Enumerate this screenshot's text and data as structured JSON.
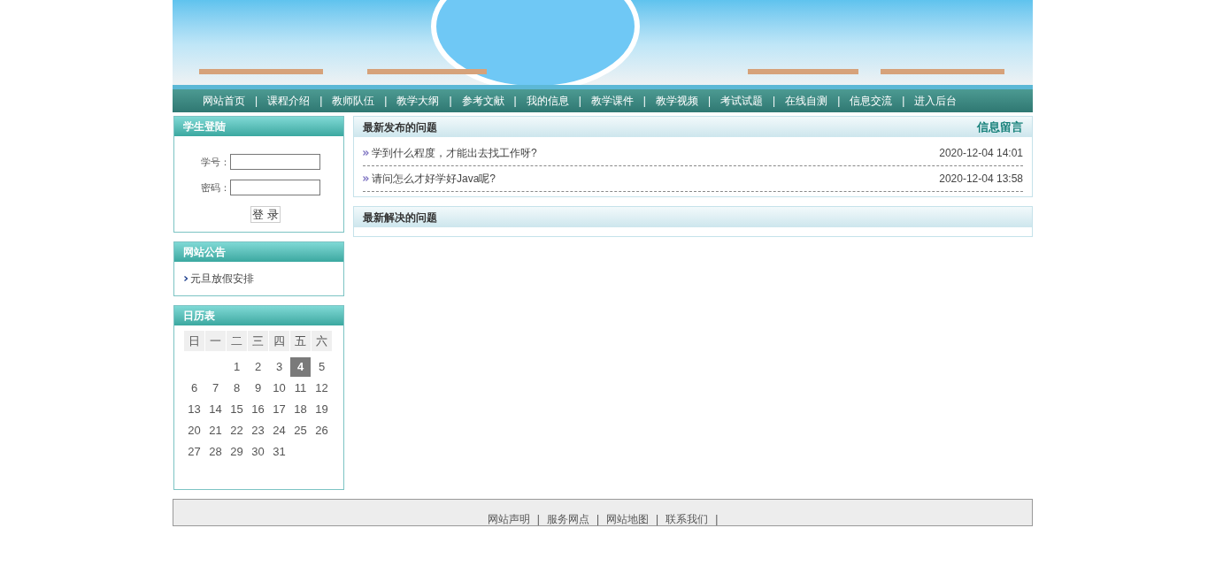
{
  "nav": {
    "items": [
      {
        "label": "网站首页",
        "separator": "|"
      },
      {
        "label": "课程介绍",
        "separator": "|"
      },
      {
        "label": "教师队伍",
        "separator": "|"
      },
      {
        "label": "教学大纲",
        "separator": "|"
      },
      {
        "label": "参考文献",
        "separator": "|"
      },
      {
        "label": "我的信息",
        "separator": "|"
      },
      {
        "label": "教学课件",
        "separator": "|"
      },
      {
        "label": "教学视频",
        "separator": "|"
      },
      {
        "label": "考试试题",
        "separator": "|"
      },
      {
        "label": "在线自测",
        "separator": "|"
      },
      {
        "label": "信息交流",
        "separator": "|"
      },
      {
        "label": "进入后台"
      }
    ]
  },
  "login": {
    "title": "学生登陆",
    "fields": [
      {
        "label": "学号："
      },
      {
        "label": "密码："
      }
    ],
    "button": "登 录"
  },
  "notice": {
    "title": "网站公告",
    "items": [
      "元旦放假安排"
    ]
  },
  "calendar": {
    "title": "日历表",
    "weekdays": [
      "日",
      "一",
      "二",
      "三",
      "四",
      "五",
      "六"
    ],
    "weeks": [
      {
        "kind": "first",
        "days": [
          {
            "day": "1",
            "selected": false
          },
          {
            "day": "2",
            "selected": false
          },
          {
            "day": "3",
            "selected": false
          },
          {
            "day": "4",
            "selected": true
          },
          {
            "day": "5",
            "selected": false
          }
        ]
      },
      {
        "kind": "middle",
        "days": [
          {
            "day": "6",
            "selected": false
          },
          {
            "day": "7",
            "selected": false
          },
          {
            "day": "8",
            "selected": false
          },
          {
            "day": "9",
            "selected": false
          },
          {
            "day": "10",
            "selected": false
          },
          {
            "day": "11",
            "selected": false
          },
          {
            "day": "12",
            "selected": false
          }
        ]
      },
      {
        "kind": "middle",
        "days": [
          {
            "day": "13",
            "selected": false
          },
          {
            "day": "14",
            "selected": false
          },
          {
            "day": "15",
            "selected": false
          },
          {
            "day": "16",
            "selected": false
          },
          {
            "day": "17",
            "selected": false
          },
          {
            "day": "18",
            "selected": false
          },
          {
            "day": "19",
            "selected": false
          }
        ]
      },
      {
        "kind": "middle",
        "days": [
          {
            "day": "20",
            "selected": false
          },
          {
            "day": "21",
            "selected": false
          },
          {
            "day": "22",
            "selected": false
          },
          {
            "day": "23",
            "selected": false
          },
          {
            "day": "24",
            "selected": false
          },
          {
            "day": "25",
            "selected": false
          },
          {
            "day": "26",
            "selected": false
          }
        ]
      },
      {
        "kind": "last",
        "days": [
          {
            "day": "27",
            "selected": false
          },
          {
            "day": "28",
            "selected": false
          },
          {
            "day": "29",
            "selected": false
          },
          {
            "day": "30",
            "selected": false
          },
          {
            "day": "31",
            "selected": false
          }
        ]
      }
    ]
  },
  "latest_questions": {
    "title": "最新发布的问题",
    "link": "信息留言",
    "items": [
      {
        "title": "学到什么程度，才能出去找工作呀?",
        "time": "2020-12-04 14:01"
      },
      {
        "title": "请问怎么才好学好Java呢?",
        "time": "2020-12-04 13:58"
      }
    ]
  },
  "solved_questions": {
    "title": "最新解决的问题"
  },
  "footer": {
    "links": [
      {
        "label": "网站声明",
        "separator": "|"
      },
      {
        "label": "服务网点",
        "separator": "|"
      },
      {
        "label": "网站地图",
        "separator": "|"
      },
      {
        "label": "联系我们",
        "separator": "|"
      }
    ]
  }
}
